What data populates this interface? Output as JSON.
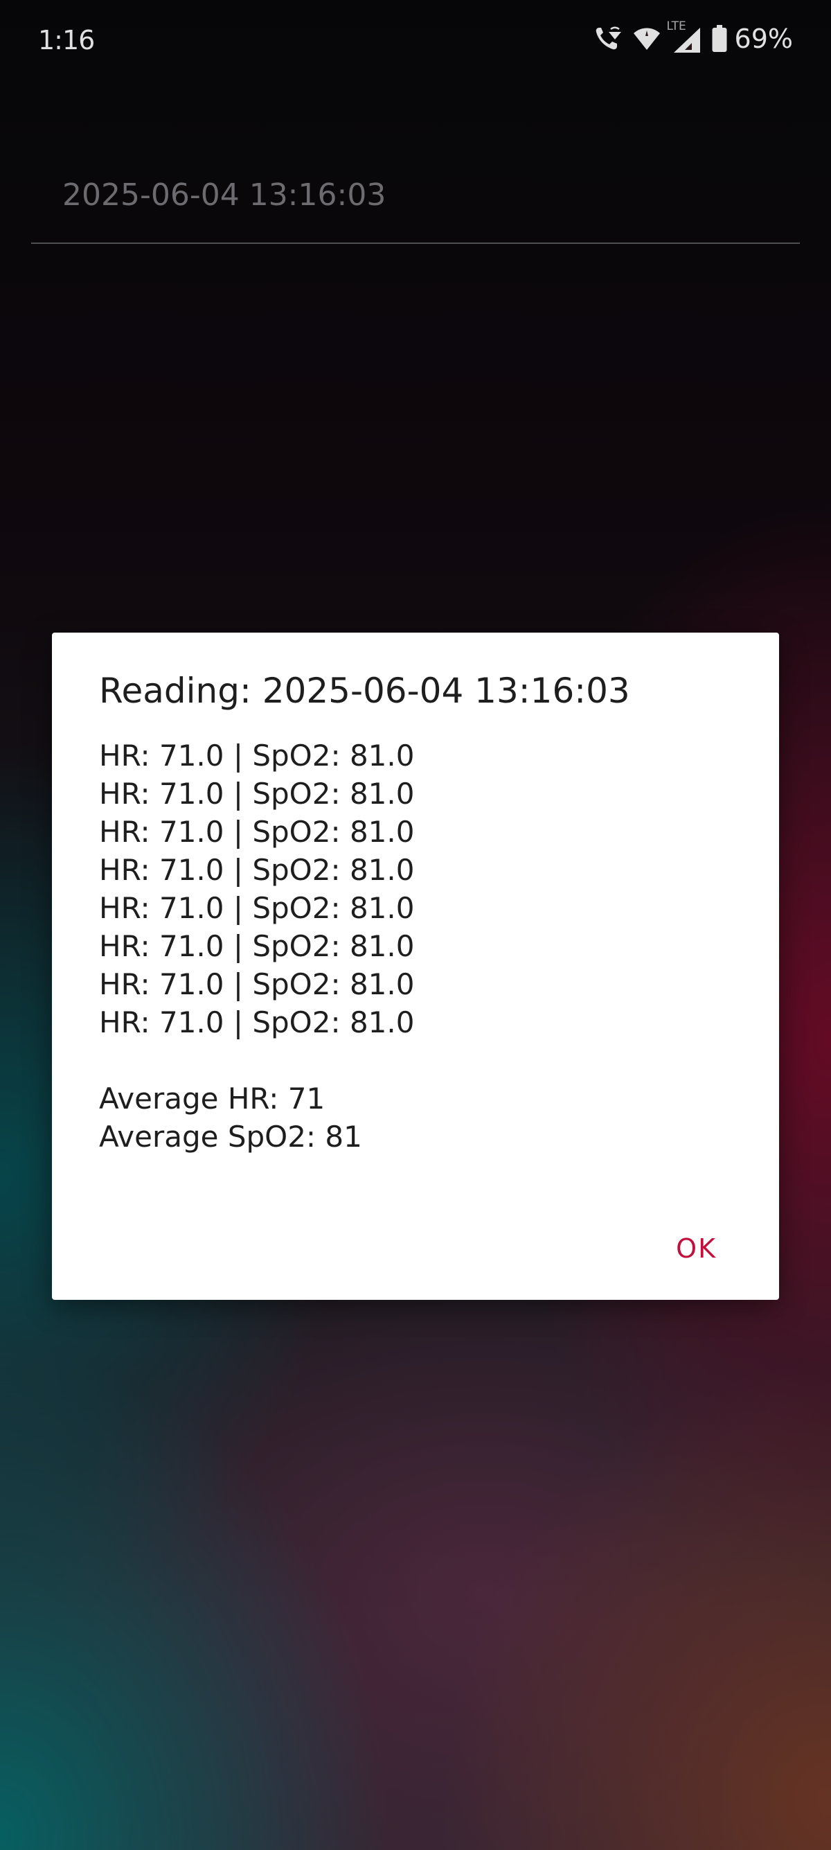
{
  "status_bar": {
    "time": "1:16",
    "network_label": "LTE",
    "battery_percent": "69%",
    "icons": [
      "wifi-calling-icon",
      "wifi-icon",
      "signal-icon",
      "battery-icon"
    ]
  },
  "background_field": {
    "date_value": "2025-06-04 13:16:03"
  },
  "dialog": {
    "title": "Reading: 2025-06-04 13:16:03",
    "readings": [
      "HR: 71.0 | SpO2: 81.0",
      "HR: 71.0 | SpO2: 81.0",
      "HR: 71.0 | SpO2: 81.0",
      "HR: 71.0 | SpO2: 81.0",
      "HR: 71.0 | SpO2: 81.0",
      "HR: 71.0 | SpO2: 81.0",
      "HR: 71.0 | SpO2: 81.0",
      "HR: 71.0 | SpO2: 81.0"
    ],
    "average_hr": "Average HR: 71",
    "average_spo2": "Average SpO2: 81",
    "ok_label": "OK"
  },
  "colors": {
    "accent": "#c2103c",
    "dialog_bg": "#ffffff",
    "text": "#1e1e1e"
  }
}
